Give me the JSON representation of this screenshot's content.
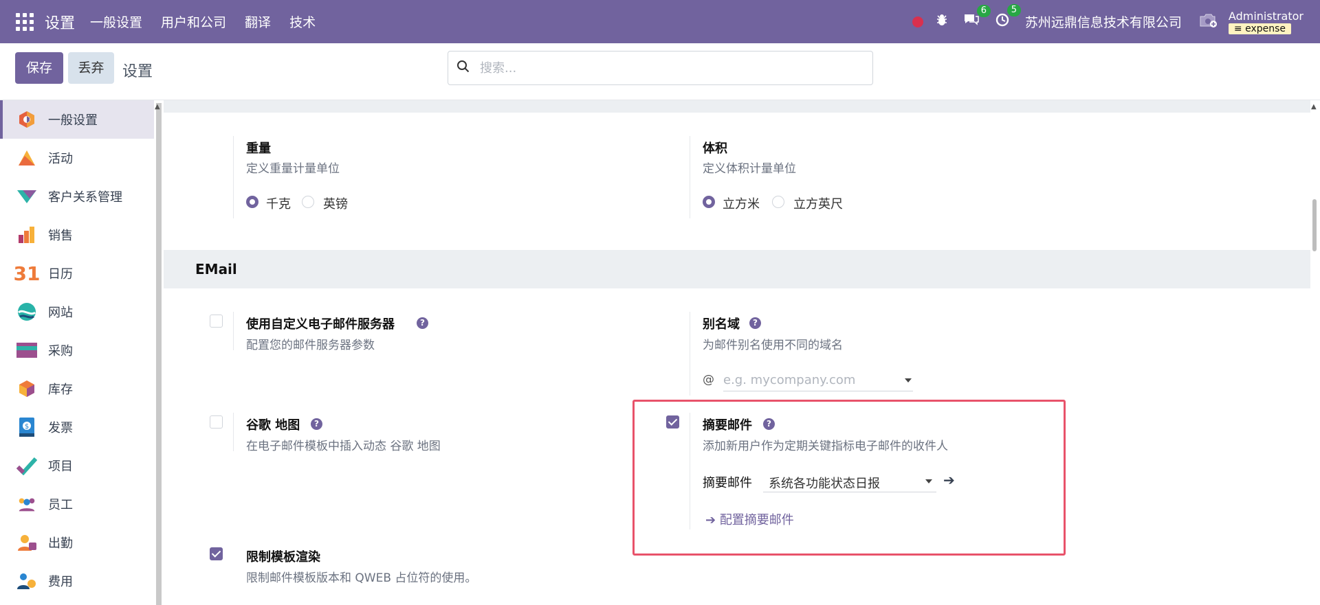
{
  "topbar": {
    "brand": "设置",
    "menu": [
      "一般设置",
      "用户和公司",
      "翻译",
      "技术"
    ],
    "messages_count": "6",
    "activities_count": "5",
    "company": "苏州远鼎信息技术有限公司",
    "user_name": "Administrator",
    "database": "expense"
  },
  "controlbar": {
    "save_label": "保存",
    "discard_label": "丢弃",
    "breadcrumb": "设置",
    "search_placeholder": "搜索..."
  },
  "sidebar": {
    "items": [
      {
        "label": "一般设置",
        "icon": "settings-app-icon",
        "active": true
      },
      {
        "label": "活动",
        "icon": "activity-app-icon"
      },
      {
        "label": "客户关系管理",
        "icon": "crm-app-icon"
      },
      {
        "label": "销售",
        "icon": "sales-app-icon"
      },
      {
        "label": "日历",
        "icon": "calendar-app-icon"
      },
      {
        "label": "网站",
        "icon": "website-app-icon"
      },
      {
        "label": "采购",
        "icon": "purchase-app-icon"
      },
      {
        "label": "库存",
        "icon": "inventory-app-icon"
      },
      {
        "label": "发票",
        "icon": "invoicing-app-icon"
      },
      {
        "label": "项目",
        "icon": "project-app-icon"
      },
      {
        "label": "员工",
        "icon": "employees-app-icon"
      },
      {
        "label": "出勤",
        "icon": "attendance-app-icon"
      },
      {
        "label": "费用",
        "icon": "expenses-app-icon"
      }
    ]
  },
  "units": {
    "weight": {
      "title": "重量",
      "desc": "定义重量计量单位",
      "options": [
        "千克",
        "英镑"
      ],
      "selected": "千克"
    },
    "volume": {
      "title": "体积",
      "desc": "定义体积计量单位",
      "options": [
        "立方米",
        "立方英尺"
      ],
      "selected": "立方米"
    }
  },
  "email": {
    "section_title": "EMail",
    "custom_server": {
      "title": "使用自定义电子邮件服务器",
      "desc": "配置您的邮件服务器参数",
      "checked": false
    },
    "alias_domain": {
      "title": "别名域",
      "desc": "为邮件别名使用不同的域名",
      "at": "@",
      "placeholder": "e.g. mycompany.com"
    },
    "google_maps": {
      "title": "谷歌 地图",
      "desc": "在电子邮件模板中插入动态 谷歌 地图",
      "checked": false
    },
    "digest": {
      "title": "摘要邮件",
      "desc": "添加新用户作为定期关键指标电子邮件的收件人",
      "field_label": "摘要邮件",
      "field_value": "系统各功能状态日报",
      "config_link": "配置摘要邮件",
      "checked": true
    },
    "restrict_templates": {
      "title": "限制模板渲染",
      "desc": "限制邮件模板版本和 QWEB 占位符的使用。",
      "checked": true
    }
  },
  "colors": {
    "brand": "#71639e",
    "highlight": "#e8526a"
  }
}
